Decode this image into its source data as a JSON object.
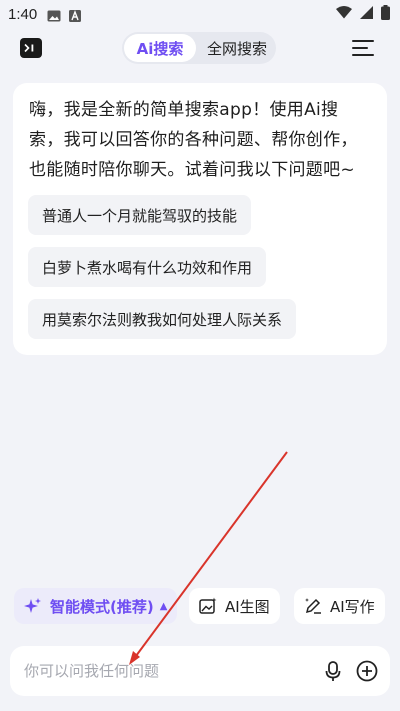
{
  "status_bar": {
    "time": "1:40",
    "icons": [
      "image-icon",
      "a-badge-icon",
      "wifi-icon",
      "signal-icon",
      "battery-icon"
    ]
  },
  "header": {
    "tabs": [
      {
        "label": "Ai搜索",
        "active": true
      },
      {
        "label": "全网搜索",
        "active": false
      }
    ],
    "left_icon": "terminal-icon",
    "right_icon": "menu-icon"
  },
  "chat": {
    "greeting_lines": [
      "嗨，我是全新的简单搜索app！使用Ai搜",
      "索，我可以回答你的各种问题、帮你创作，",
      "也能随时陪你聊天。试着问我以下问题吧~"
    ],
    "suggestions": [
      "普通人一个月就能驾驭的技能",
      "白萝卜煮水喝有什么功效和作用",
      "用莫索尔法则教我如何处理人际关系"
    ]
  },
  "modes": {
    "smart": "智能模式(推荐)",
    "image": "AI生图",
    "write": "AI写作"
  },
  "input": {
    "placeholder": "你可以问我任何问题",
    "value": ""
  },
  "colors": {
    "accent": "#6f4ef2",
    "background": "#f2f3f8",
    "annotation_arrow": "#d9342b"
  }
}
